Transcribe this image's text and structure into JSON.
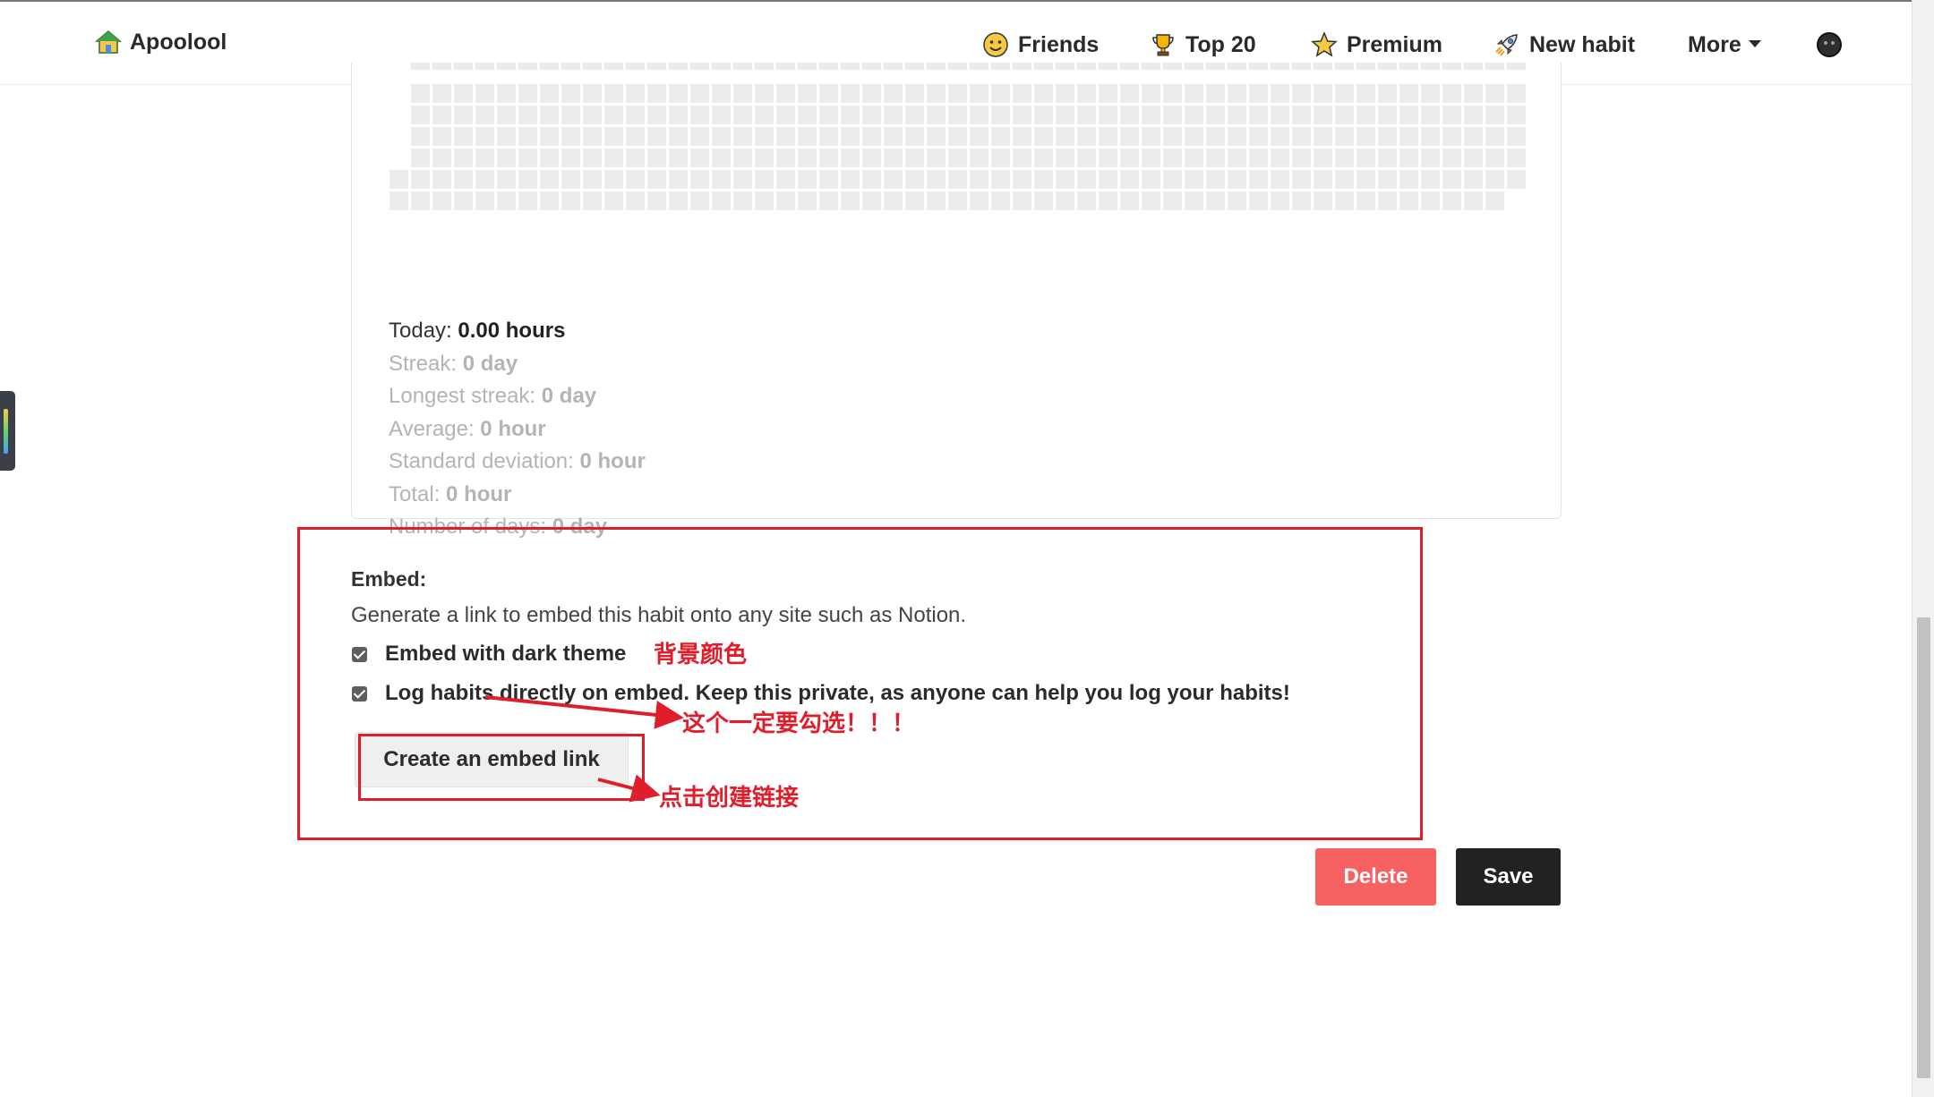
{
  "navbar": {
    "brand": "Apoolool",
    "items": [
      {
        "label": "Friends",
        "icon": "smiley-icon"
      },
      {
        "label": "Top 20",
        "icon": "trophy-icon"
      },
      {
        "label": "Premium",
        "icon": "star-icon"
      },
      {
        "label": "New habit",
        "icon": "rocket-icon"
      },
      {
        "label": "More",
        "icon": "caret-down-icon"
      }
    ]
  },
  "stats": {
    "today_label": "Today:",
    "today_value": "0.00 hours",
    "streak_label": "Streak:",
    "streak_value": "0 day",
    "longest_label": "Longest streak:",
    "longest_value": "0 day",
    "average_label": "Average:",
    "average_value": "0 hour",
    "stddev_label": "Standard deviation:",
    "stddev_value": "0 hour",
    "total_label": "Total:",
    "total_value": "0 hour",
    "days_label": "Number of days:",
    "days_value": "0 day"
  },
  "embed": {
    "title": "Embed:",
    "description": "Generate a link to embed this habit onto any site such as Notion.",
    "dark_theme_label": "Embed with dark theme",
    "dark_theme_checked": true,
    "log_label": "Log habits directly on embed. Keep this private, as anyone can help you log your habits!",
    "log_checked": true,
    "button_label": "Create an embed link"
  },
  "actions": {
    "delete_label": "Delete",
    "save_label": "Save"
  },
  "annotations": {
    "dark_theme_note": "背景颜色",
    "log_note": "这个一定要勾选！！！",
    "button_note": "点击创建链接",
    "color": "#e01e2b"
  }
}
